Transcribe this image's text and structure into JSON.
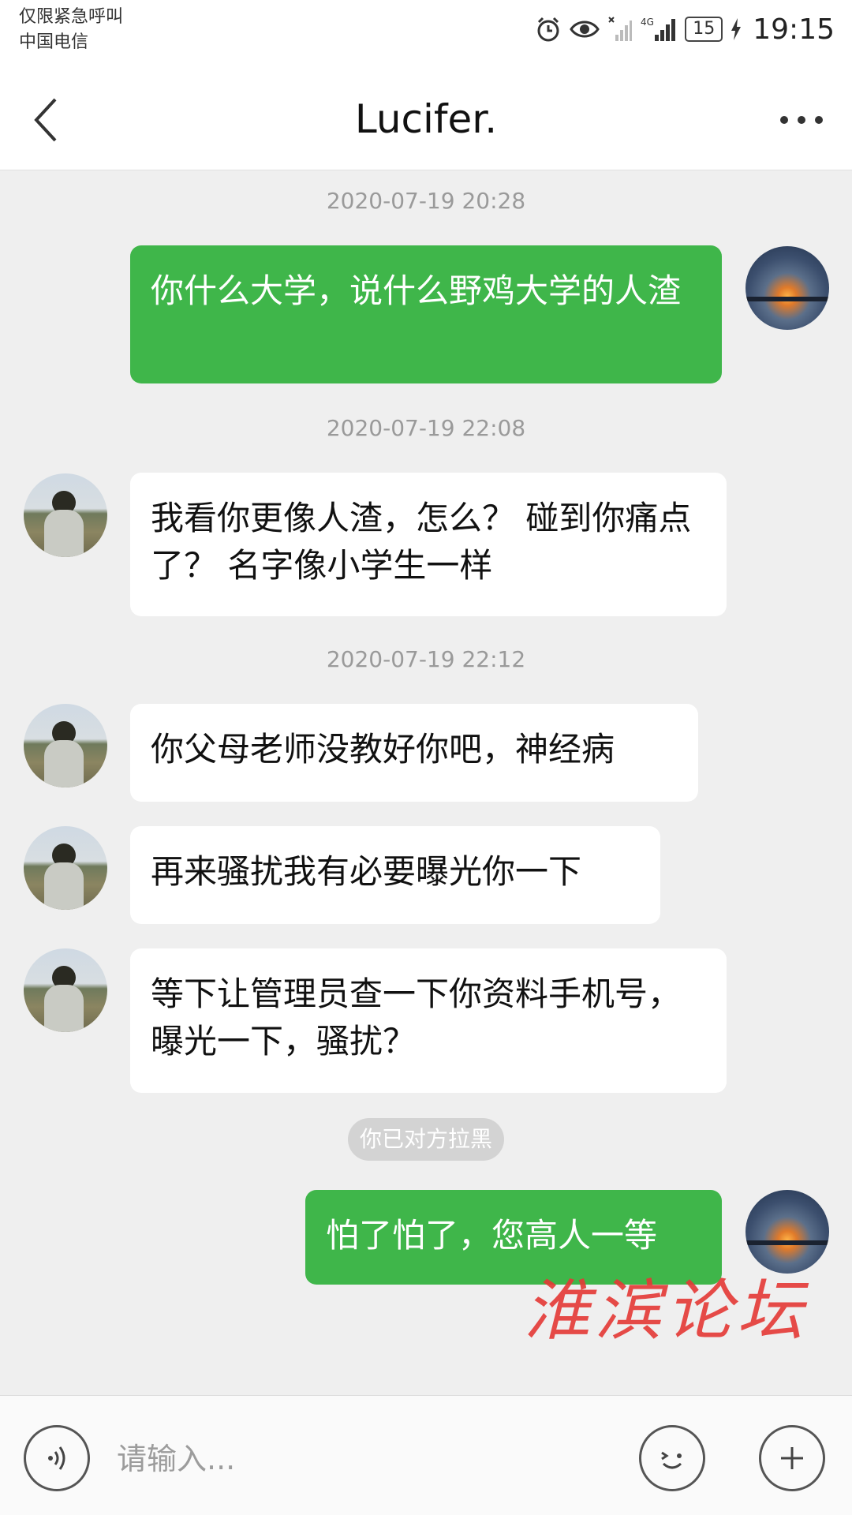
{
  "status_bar": {
    "carrier_line1": "仅限紧急呼叫",
    "carrier_line2": "中国电信",
    "network_label": "4G",
    "battery": "15",
    "time": "19:15"
  },
  "nav": {
    "title": "Lucifer.",
    "back_icon": "chevron-left-icon",
    "more_icon": "more-dots-icon"
  },
  "messages": [
    {
      "type": "timestamp",
      "text": "2020-07-19 20:28"
    },
    {
      "type": "message",
      "direction": "outgoing",
      "text": "你什么大学，说什么野鸡大学的人渣"
    },
    {
      "type": "timestamp",
      "text": "2020-07-19 22:08"
    },
    {
      "type": "message",
      "direction": "incoming",
      "text": "我看你更像人渣，怎么？ 碰到你痛点了？ 名字像小学生一样"
    },
    {
      "type": "timestamp",
      "text": "2020-07-19 22:12"
    },
    {
      "type": "message",
      "direction": "incoming",
      "text": "你父母老师没教好你吧，神经病"
    },
    {
      "type": "message",
      "direction": "incoming",
      "text": "再来骚扰我有必要曝光你一下"
    },
    {
      "type": "message",
      "direction": "incoming",
      "text": "等下让管理员查一下你资料手机号，曝光一下，骚扰？"
    },
    {
      "type": "system",
      "text": "你已对方拉黑"
    },
    {
      "type": "message",
      "direction": "outgoing",
      "text": "怕了怕了，您高人一等"
    }
  ],
  "watermark": "淮滨论坛",
  "input_bar": {
    "placeholder": "请输入...",
    "voice_icon": "voice-icon",
    "emoji_icon": "emoji-icon",
    "plus_icon": "plus-icon"
  },
  "colors": {
    "outgoing_bubble": "#3fb64a",
    "incoming_bubble": "#ffffff",
    "chat_background": "#efefef",
    "watermark": "#e53935"
  }
}
